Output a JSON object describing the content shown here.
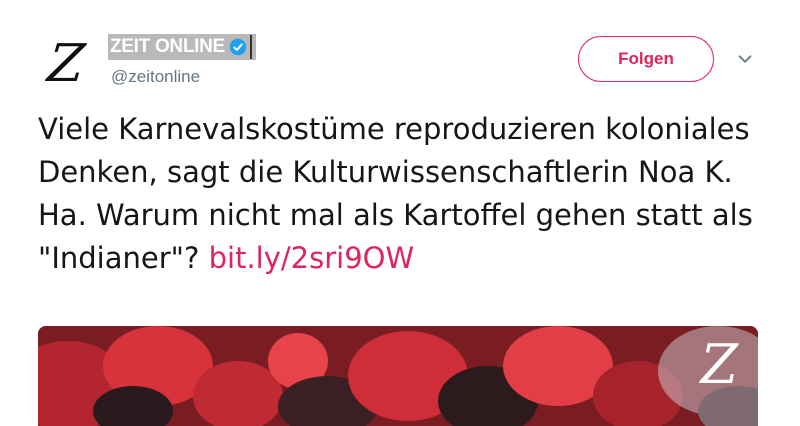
{
  "account": {
    "avatar_letter": "Z",
    "name": "ZEIT ONLINE",
    "handle": "@zeitonline",
    "verified_icon": "verified-badge-icon"
  },
  "actions": {
    "follow_label": "Folgen",
    "more_icon": "chevron-down-icon"
  },
  "tweet": {
    "text": "Viele Karnevalskostüme reproduzieren koloniales Denken, sagt die Kulturwissenschaftlerin Noa K. Ha. Warum nicht mal als Kartoffel gehen statt als \"Indianer\"? ",
    "link": "bit.ly/2sri9OW"
  },
  "media": {
    "logo_letter": "Z"
  },
  "colors": {
    "accent": "#e0245e",
    "verified": "#1da1f2",
    "handle": "#657786"
  }
}
